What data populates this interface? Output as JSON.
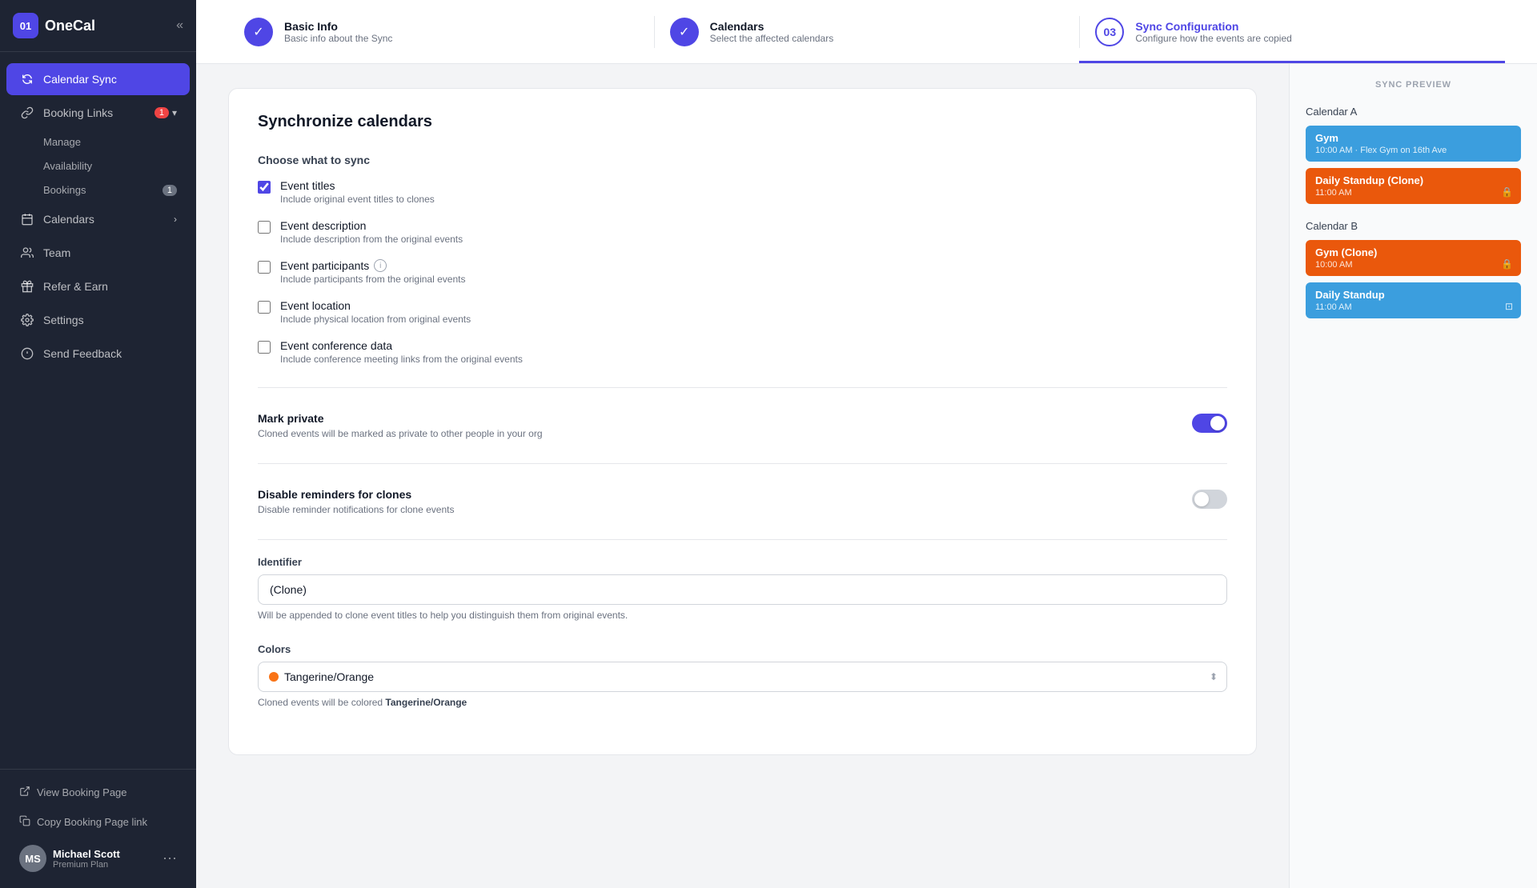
{
  "app": {
    "logo_text": "OneCal",
    "logo_initials": "01",
    "collapse_icon": "«"
  },
  "sidebar": {
    "nav_items": [
      {
        "id": "calendar-sync",
        "label": "Calendar Sync",
        "icon": "sync",
        "active": true
      },
      {
        "id": "booking-links",
        "label": "Booking Links",
        "icon": "link",
        "badge": "1",
        "arrow": "▾"
      },
      {
        "id": "manage",
        "label": "Manage",
        "sub": true
      },
      {
        "id": "availability",
        "label": "Availability",
        "sub": true
      },
      {
        "id": "bookings",
        "label": "Bookings",
        "sub": true,
        "sub_badge": "1"
      },
      {
        "id": "calendars",
        "label": "Calendars",
        "icon": "calendar",
        "arrow": "›"
      },
      {
        "id": "team",
        "label": "Team",
        "icon": "team"
      },
      {
        "id": "refer-earn",
        "label": "Refer & Earn",
        "icon": "gift"
      },
      {
        "id": "settings",
        "label": "Settings",
        "icon": "gear"
      },
      {
        "id": "send-feedback",
        "label": "Send Feedback",
        "icon": "feedback"
      }
    ],
    "footer": {
      "view_booking_page": "View Booking Page",
      "copy_booking_link": "Copy Booking Page link"
    },
    "user": {
      "name": "Michael Scott",
      "plan": "Premium Plan",
      "initials": "MS"
    }
  },
  "stepper": {
    "steps": [
      {
        "id": "basic-info",
        "number": "✓",
        "title": "Basic Info",
        "subtitle": "Basic info about the Sync",
        "status": "completed"
      },
      {
        "id": "calendars",
        "number": "✓",
        "title": "Calendars",
        "subtitle": "Select the affected calendars",
        "status": "completed"
      },
      {
        "id": "sync-config",
        "number": "03",
        "title": "Sync Configuration",
        "subtitle": "Configure how the events are copied",
        "status": "current"
      }
    ]
  },
  "form": {
    "title": "Synchronize calendars",
    "sync_section_title": "Choose what to sync",
    "checkboxes": [
      {
        "id": "event-titles",
        "label": "Event titles",
        "sub": "Include original event titles to clones",
        "checked": true
      },
      {
        "id": "event-description",
        "label": "Event description",
        "sub": "Include description from the original events",
        "checked": false
      },
      {
        "id": "event-participants",
        "label": "Event participants",
        "sub": "Include participants from the original events",
        "checked": false,
        "info": true
      },
      {
        "id": "event-location",
        "label": "Event location",
        "sub": "Include physical location from original events",
        "checked": false
      },
      {
        "id": "event-conference",
        "label": "Event conference data",
        "sub": "Include conference meeting links from the original events",
        "checked": false
      }
    ],
    "toggles": [
      {
        "id": "mark-private",
        "title": "Mark private",
        "sub": "Cloned events will be marked as private to other people in your org",
        "enabled": true
      },
      {
        "id": "disable-reminders",
        "title": "Disable reminders for clones",
        "sub": "Disable reminder notifications for clone events",
        "enabled": false
      }
    ],
    "identifier": {
      "label": "Identifier",
      "value": "(Clone)",
      "placeholder": "(Clone)",
      "hint_prefix": "Will be appended to clone event titles to help you distinguish them from original events."
    },
    "colors": {
      "label": "Colors",
      "selected": "Tangerine/Orange",
      "hint_prefix": "Cloned events will be colored",
      "hint_color": "Tangerine/Orange",
      "dot_color": "#f97316"
    }
  },
  "preview": {
    "title": "SYNC PREVIEW",
    "calendar_a_label": "Calendar A",
    "calendar_b_label": "Calendar B",
    "events_a": [
      {
        "title": "Gym",
        "sub": "10:00 AM · Flex Gym on 16th Ave",
        "color": "blue",
        "icon": ""
      },
      {
        "title": "Daily Standup (Clone)",
        "sub": "11:00 AM",
        "color": "orange",
        "icon": "🔒"
      }
    ],
    "events_b": [
      {
        "title": "Gym (Clone)",
        "sub": "10:00 AM",
        "color": "orange",
        "icon": "🔒"
      },
      {
        "title": "Daily Standup",
        "sub": "11:00 AM",
        "color": "blue",
        "icon": "⊡"
      }
    ]
  }
}
